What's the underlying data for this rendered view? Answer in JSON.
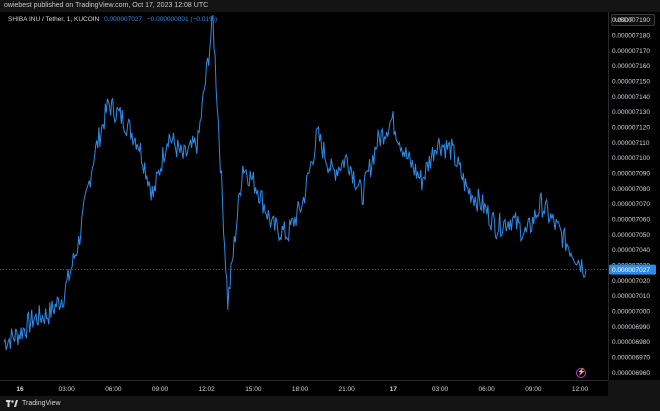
{
  "header": {
    "published_text": "owiebest published on TradingView.com, Oct 17, 2023 12:08 UTC"
  },
  "symbol": {
    "name": "SHIBA INU / Tether, 1, KUCOIN",
    "last_price": "0.000007027",
    "change": "−0.000000001 (−0.01%)"
  },
  "price_axis": {
    "currency": "USDT",
    "current_price_label": "0.000007027",
    "ticks": [
      "0.000007190",
      "0.000007180",
      "0.000007170",
      "0.000007160",
      "0.000007150",
      "0.000007140",
      "0.000007130",
      "0.000007120",
      "0.000007110",
      "0.000007100",
      "0.000007090",
      "0.000007080",
      "0.000007070",
      "0.000007060",
      "0.000007050",
      "0.000007040",
      "0.000007030",
      "0.000007020",
      "0.000007010",
      "0.000007000",
      "0.000006990",
      "0.000006980",
      "0.000006970",
      "0.000006960"
    ]
  },
  "time_axis": {
    "ticks": [
      "16",
      "03:00",
      "06:00",
      "09:00",
      "12:02",
      "15:00",
      "18:00",
      "21:00",
      "17",
      "03:00",
      "06:00",
      "09:00",
      "12:00"
    ]
  },
  "footer": {
    "brand": "TradingView"
  },
  "colors": {
    "line": "#2e8ae6",
    "background": "#000000",
    "axis_text": "#d1d4dc",
    "price_tag": "#2e8ae6"
  },
  "chart_data": {
    "type": "line",
    "title": "SHIBA INU / Tether, 1, KUCOIN",
    "xlabel": "",
    "ylabel": "",
    "ylim": [
      6.955e-06,
      7.195e-06
    ],
    "grid": false,
    "x": [
      "16 00:00",
      "01:00",
      "02:00",
      "03:00",
      "04:00",
      "05:00",
      "05:30",
      "06:00",
      "07:00",
      "08:00",
      "09:00",
      "10:00",
      "11:00",
      "12:02",
      "13:00",
      "13:40",
      "14:00",
      "15:00",
      "16:00",
      "17:00",
      "18:00",
      "19:00",
      "20:00",
      "21:00",
      "22:00",
      "23:00",
      "17 00:00",
      "01:00",
      "02:00",
      "03:00",
      "04:00",
      "05:00",
      "06:00",
      "07:00",
      "08:00",
      "09:00",
      "10:00",
      "11:00",
      "11:30",
      "12:00"
    ],
    "series": [
      {
        "values": [
          6.98e-06,
          6.985e-06,
          6.995e-06,
          6.998e-06,
          7.01e-06,
          7.045e-06,
          7.1e-06,
          7.135e-06,
          7.125e-06,
          7.11e-06,
          7.075e-06,
          7.115e-06,
          7.1e-06,
          7.11e-06,
          7.19e-06,
          7.005e-06,
          7.095e-06,
          7.08e-06,
          7.055e-06,
          7.05e-06,
          7.07e-06,
          7.115e-06,
          7.09e-06,
          7.1e-06,
          7.075e-06,
          7.11e-06,
          7.125e-06,
          7.1e-06,
          7.085e-06,
          7.11e-06,
          7.105e-06,
          7.08e-06,
          7.07e-06,
          7.055e-06,
          7.06e-06,
          7.05e-06,
          7.07e-06,
          7.055e-06,
          7.04e-06,
          7.027e-06
        ]
      }
    ]
  }
}
